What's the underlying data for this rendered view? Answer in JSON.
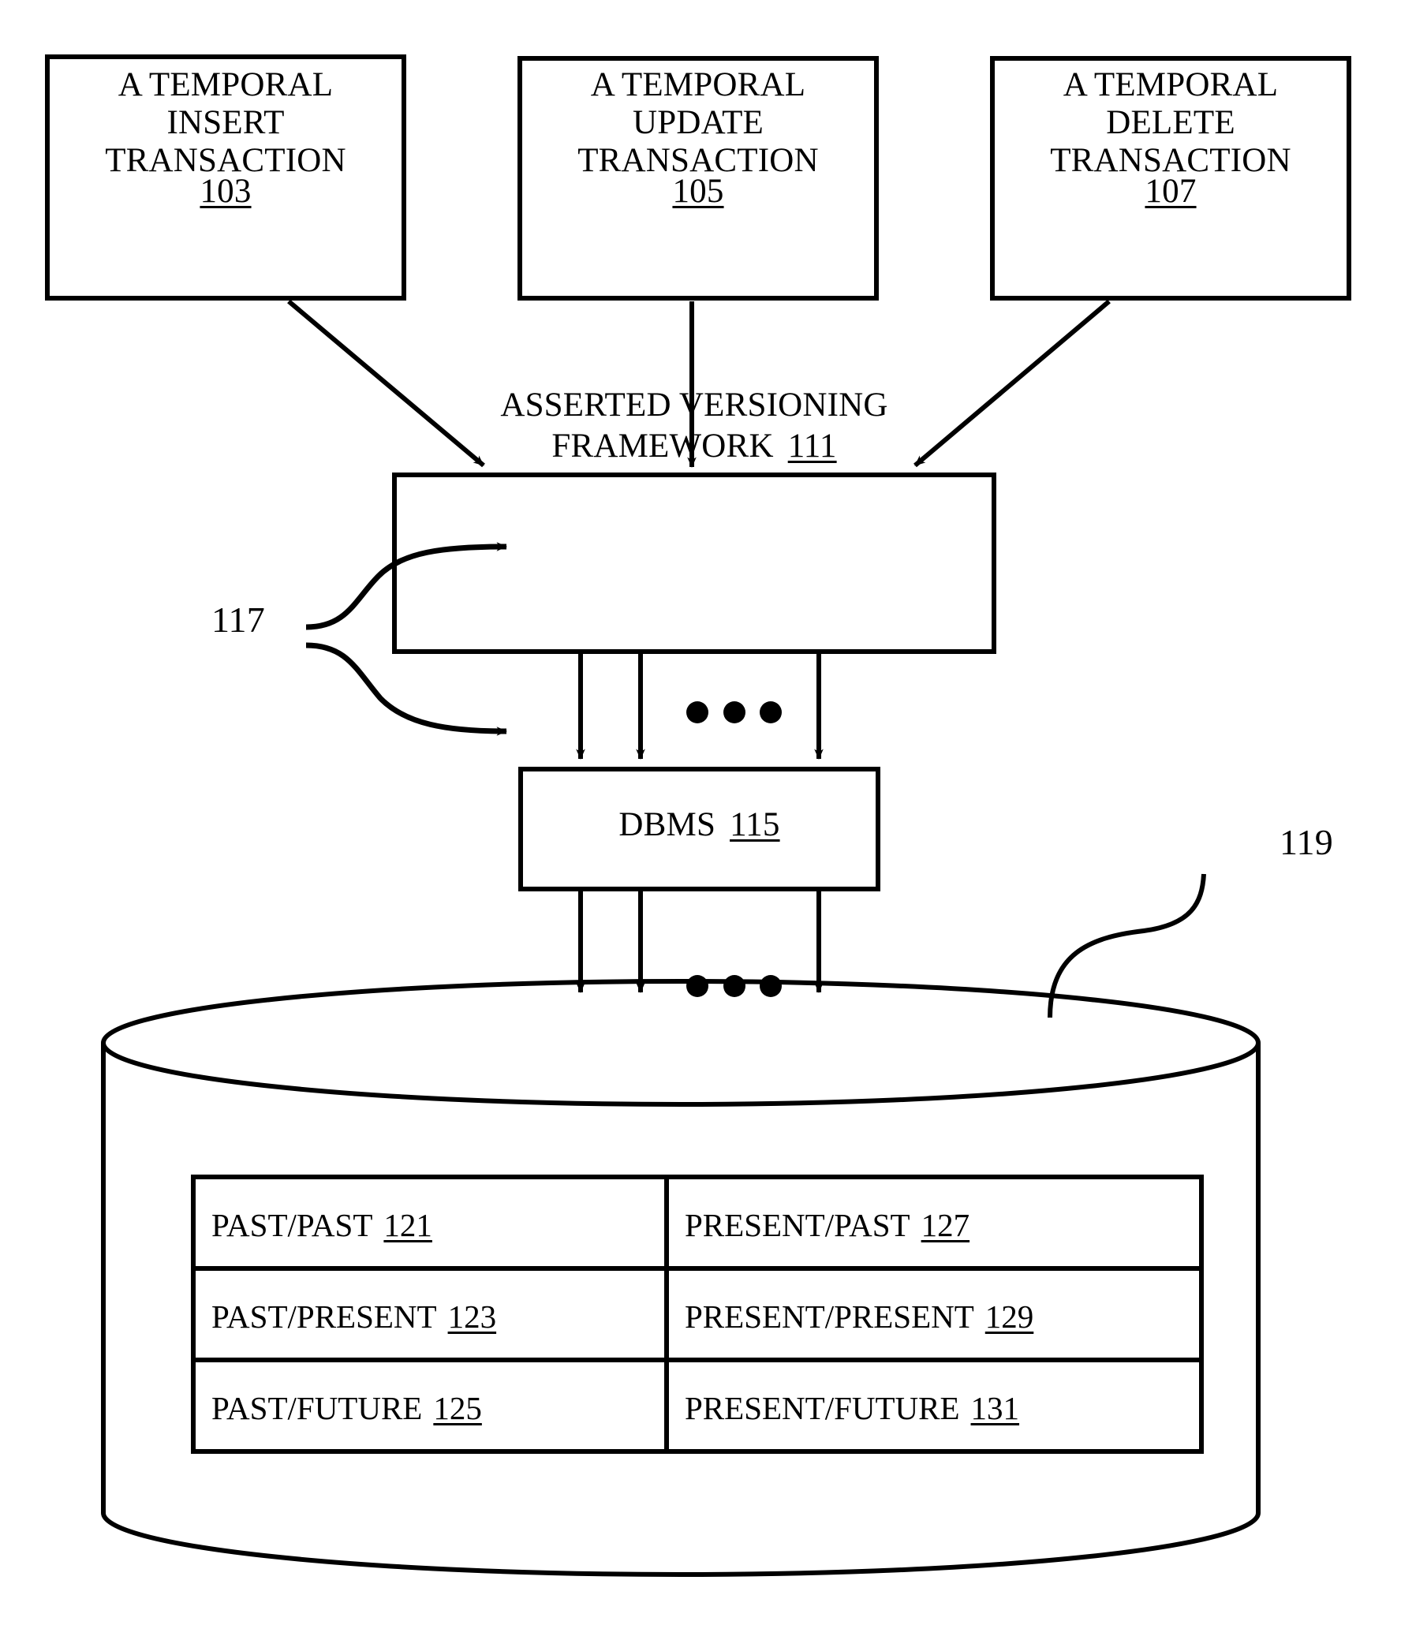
{
  "figure": {
    "title": "Asserted Versioning Framework architecture diagram",
    "line_color": "#000000",
    "background_color": "#ffffff"
  },
  "transaction_boxes": [
    {
      "label": "A TEMPORAL\nINSERT\nTRANSACTION",
      "ref": "103"
    },
    {
      "label": "A TEMPORAL\nUPDATE\nTRANSACTION",
      "ref": "105"
    },
    {
      "label": "A TEMPORAL\nDELETE\nTRANSACTION",
      "ref": "107"
    }
  ],
  "framework_box": {
    "line1": "ASSERTED VERSIONING",
    "line2": "FRAMEWORK",
    "ref": "111"
  },
  "dbms_box": {
    "label": "DBMS",
    "ref": "115"
  },
  "connector_labels": {
    "interfaces_ref": "117",
    "database_ref": "119"
  },
  "ellipsis": {
    "upper": "• • •",
    "lower": "• • •"
  },
  "database_table": {
    "rows": [
      {
        "left": {
          "label": "PAST/PAST",
          "ref": "121"
        },
        "right": {
          "label": "PRESENT/PAST",
          "ref": "127"
        }
      },
      {
        "left": {
          "label": "PAST/PRESENT",
          "ref": "123"
        },
        "right": {
          "label": "PRESENT/PRESENT",
          "ref": "129"
        }
      },
      {
        "left": {
          "label": "PAST/FUTURE",
          "ref": "125"
        },
        "right": {
          "label": "PRESENT/FUTURE",
          "ref": "131"
        }
      }
    ]
  }
}
